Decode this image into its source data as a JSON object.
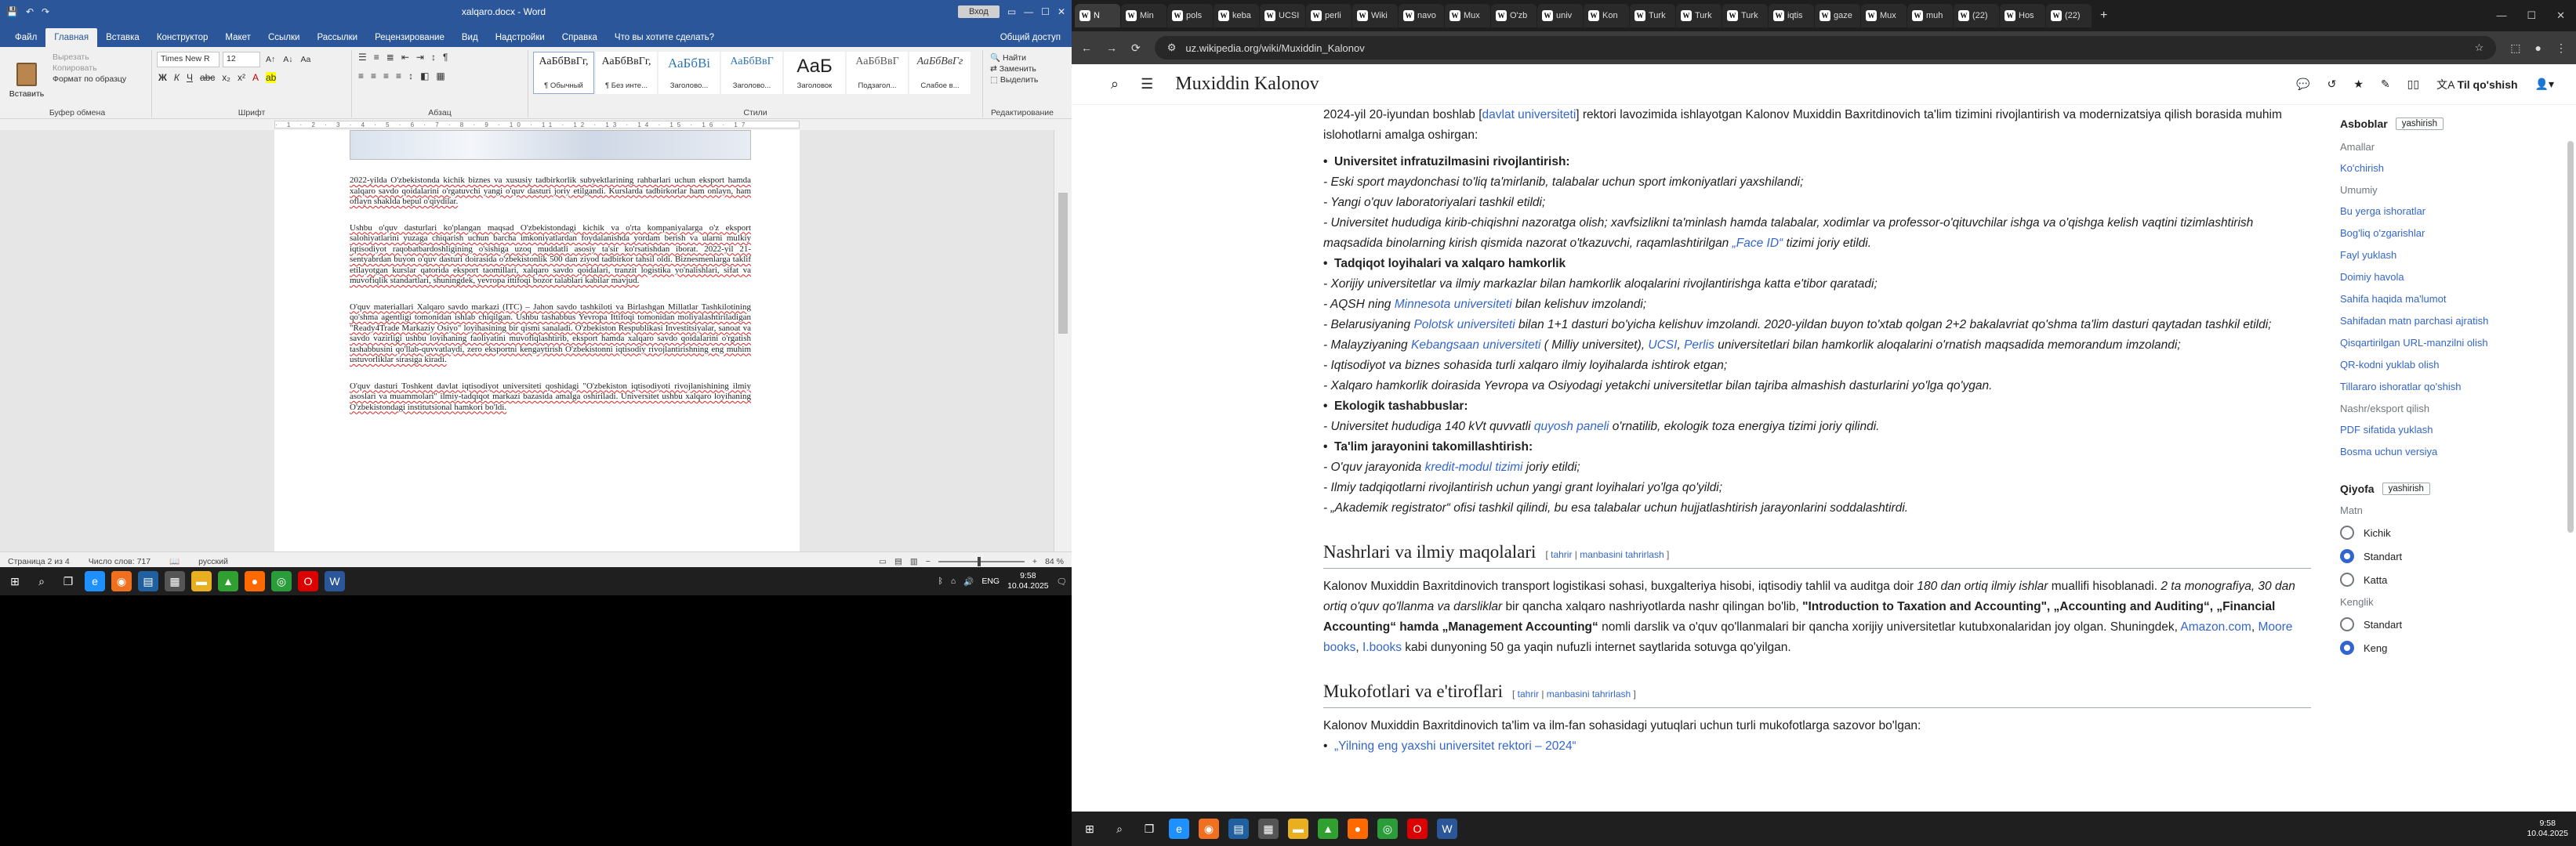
{
  "word": {
    "title": "xalqaro.docx - Word",
    "login": "Вход",
    "tabs": [
      "Файл",
      "Главная",
      "Вставка",
      "Конструктор",
      "Макет",
      "Ссылки",
      "Рассылки",
      "Рецензирование",
      "Вид",
      "Надстройки",
      "Справка",
      "Что вы хотите сделать?"
    ],
    "share": "Общий доступ",
    "clipboard": {
      "paste": "Вставить",
      "cut": "Вырезать",
      "copy": "Копировать",
      "format": "Формат по образцу",
      "label": "Буфер обмена"
    },
    "font": {
      "name": "Times New R",
      "size": "12",
      "label": "Шрифт"
    },
    "para_label": "Абзац",
    "styles": {
      "label": "Стили",
      "items": [
        {
          "sample": "АаБбВвГг,",
          "name": "¶ Обычный"
        },
        {
          "sample": "АаБбВвГг,",
          "name": "¶ Без инте..."
        },
        {
          "sample": "АаБбВі",
          "name": "Заголово..."
        },
        {
          "sample": "АаБбВвГ",
          "name": "Заголово..."
        },
        {
          "sample": "АаБ",
          "name": "Заголовок"
        },
        {
          "sample": "АаБбВвГ",
          "name": "Подзагол..."
        },
        {
          "sample": "АаБбВвГг",
          "name": "Слабое в..."
        }
      ]
    },
    "editing": {
      "find": "Найти",
      "replace": "Заменить",
      "select": "Выделить",
      "label": "Редактирование"
    },
    "doc": {
      "p1": "2022-yilda O'zbekistonda kichik biznes va xususiy tadbirkorlik subyektlarining rahbarlari uchun eksport hamda xalqaro savdo qoidalarini o'rgatuvchi yangi o'quv dasturi joriy etilgandi. Kurslarda tadbirkorlar ham onlayn, ham oflayn shaklda bepul o'qiydilar.",
      "p2": "Ushbu o'quv dasturlari ko'plangan maqsad O'zbekistondagi kichik va o'rta kompaniyalarga o'z eksport salohiyatlarini yuzaga chiqarish uchun barcha imkoniyatlardan foydalanishda yordam berish va ularni mulkiy iqtisodiyot raqobatbardoshligining o'sishiga uzoq muddatli asosiy ta'sir ko'rsatishdan iborat. 2022-yil 21-sentyabrdan buyon o'quv dasturi doirasida o'zbekistonlik 500 dan ziyod tadbirkor tahsil oldi. Biznesmenlarga taklif etilayotgan kurslar qatorida eksport taomillari, xalqaro savdo qoidalari, tranzit logistika yo'nalishlari, sifat va muvofiqlik standartlari, shuningdek, yevropa ittifoqi bozor talablari kabilar mavjud.",
      "p3": "O'quv materiallari Xalqaro savdo markazi (ITC) – Jahon savdo tashkiloti va Birlashgan Millatlar Tashkilotining qo'shma agentligi tomonidan ishlab chiqilgan. Ushbu tashabbus Yevropa Ittifoqi tomonidan moliyalashtiriladigan \"Ready4Trade Markaziy Osiyo\" loyihasining bir qismi sanaladi. O'zbekiston Respublikasi Investitsiyalar, sanoat va savdo vazirligi ushbu loyihaning faoliyatini muvofiqlashtirib, eksport hamda xalqaro savdo qoidalarini o'rgatish tashabbusini qo'llab-quvvatlaydi, zero eksportni kengaytirish O'zbekistonni iqtisodiy rivojlantirishning eng muhim ustuvorliklar sirasiga kiradi.",
      "p4": "O'quv dasturi Toshkent davlat iqtisodiyot universiteti qoshidagi \"O'zbekiston iqtisodiyoti rivojlanishining ilmiy asoslari va muammolari\" ilmiy-tadqiqot markazi bazasida amalga oshiriladi. Universitet ushbu xalqaro loyihaning O'zbekistondagi institutsional hamkori bo'ldi."
    },
    "status": {
      "page": "Страница 2 из 4",
      "words": "Число слов: 717",
      "lang": "русский",
      "zoom": "84 %"
    },
    "taskbar": {
      "lang": "ENG",
      "time": "9:58",
      "date": "10.04.2025"
    }
  },
  "browser": {
    "tabs": [
      "N",
      "Min",
      "pols",
      "keba",
      "UCSI",
      "perli",
      "Wiki",
      "navo",
      "Mux",
      "O'zb",
      "univ",
      "Kon",
      "Turk",
      "Turk",
      "Turk",
      "iqtis",
      "gaze",
      "Mux",
      "muh",
      "(22)",
      "Hos",
      "(22)"
    ],
    "url": "uz.wikipedia.org/wiki/Muxiddin_Kalonov",
    "header": {
      "title": "Muxiddin Kalonov",
      "lang": "Til qo'shish"
    },
    "intro": {
      "a": "2024-yil 20-iyundan boshlab ",
      "link": "davlat universiteti",
      "b": "] rektori lavozimida ishlayotgan Kalonov Muxiddin Baxritdinovich ta'lim tizimini rivojlantirish va modernizatsiya qilish borasida muhim islohotlarni amalga oshirgan:"
    },
    "infra": {
      "h": "Universitet infratuzilmasini rivojlantirish:",
      "i1": "- Eski sport maydonchasi to'liq ta'mirlanib, talabalar uchun sport imkoniyatlari yaxshilandi;",
      "i2": "- Yangi o'quv laboratoriyalari tashkil etildi;",
      "i3a": "- Universitet hududiga kirib-chiqishni nazoratga olish; xavfsizlikni ta'minlash hamda talabalar, xodimlar va professor-o'qituvchilar ishga va o'qishga kelish vaqtini tizimlashtirish maqsadida binolarning kirish qismida nazorat o'tkazuvchi, raqamlashtirilgan ",
      "i3l": "„Face ID“",
      "i3b": " tizimi joriy etildi."
    },
    "coop": {
      "h": "Tadqiqot loyihalari va xalqaro hamkorlik",
      "i1": "- Xorijiy universitetlar va ilmiy markazlar bilan hamkorlik aloqalarini rivojlantirishga katta e'tibor qaratadi;",
      "i2a": "- AQSH ning ",
      "i2l": "Minnesota universiteti",
      "i2b": " bilan kelishuv imzolandi;",
      "i3a": "- Belarusiyaning ",
      "i3l": "Polotsk universiteti",
      "i3b": " bilan 1+1 dasturi bo'yicha kelishuv imzolandi. 2020-yildan buyon to'xtab qolgan 2+2 bakalavriat qo'shma ta'lim dasturi qaytadan tashkil etildi;",
      "i4a": "- Malayziyaning ",
      "i4l": "Kebangsaan universiteti",
      "i4b": " ( Milliy universitet), ",
      "i4l2": "UCSI",
      "i4c": ", ",
      "i4l3": "Perlis",
      "i4d": " universitetlari bilan hamkorlik aloqalarini o'rnatish maqsadida memorandum imzolandi;",
      "i5": "- Iqtisodiyot va biznes sohasida turli xalqaro ilmiy loyihalarda ishtirok etgan;",
      "i6": "- Xalqaro hamkorlik doirasida Yevropa va Osiyodagi yetakchi universitetlar bilan tajriba almashish dasturlarini yo'lga qo'ygan."
    },
    "eco": {
      "h": "Ekologik tashabbuslar:",
      "i1a": "- Universitet hududiga 140 kVt quvvatli ",
      "i1l": "quyosh paneli",
      "i1b": " o'rnatilib, ekologik toza energiya tizimi joriy qilindi."
    },
    "edu": {
      "h": "Ta'lim jarayonini takomillashtirish:",
      "i1a": "- O'quv jarayonida ",
      "i1l": "kredit-modul tizimi",
      "i1b": " joriy etildi;",
      "i2": "- Ilmiy tadqiqotlarni rivojlantirish uchun yangi grant loyihalari yo'lga qo'yildi;",
      "i3": "- „Akademik registrator“ ofisi tashkil qilindi, bu esa talabalar uchun hujjatlashtirish jarayonlarini soddalashtirdi."
    },
    "pub": {
      "h": "Nashrlari va ilmiy maqolalari",
      "edit": "tahrir",
      "editsrc": "manbasini tahrirlash",
      "t1": "Kalonov Muxiddin Baxritdinovich transport logistikasi sohasi, buxgalteriya hisobi, iqtisodiy tahlil va auditga doir ",
      "t1i": "180 dan ortiq ilmiy ishlar",
      "t2": " muallifi hisoblanadi. ",
      "t2i": "2 ta monografiya, 30 dan ortiq o'quv qo'llanma va darsliklar",
      "t3": " bir qancha xalqaro nashriyotlarda nashr qilingan bo'lib, ",
      "t3b": "\"Introduction to Taxation and Accounting\", „Accounting and Auditing“, „Financial Accounting“ hamda „Management Accounting“",
      "t4": " nomli darslik va o'quv qo'llanmalari bir qancha xorijiy universitetlar kutubxonalaridan joy olgan. Shuningdek, ",
      "l1": "Amazon.com",
      "l2": "Moore books",
      "l3": "I.books",
      "t5": " kabi dunyoning 50 ga yaqin nufuzli internet saytlarida sotuvga qo'yilgan."
    },
    "awards": {
      "h": "Mukofotlari va e'tiroflari",
      "t": "Kalonov Muxiddin Baxritdinovich ta'lim va ilm-fan sohasidagi yutuqlari uchun turli mukofotlarga sazovor bo'lgan:",
      "i1": "„Yilning eng yaxshi universitet rektori – 2024“"
    },
    "sidebar": {
      "tools": "Asboblar",
      "hide": "yashirish",
      "actions": "Amallar",
      "whatlinks": "Ko'chirish",
      "general": "Umumiy",
      "links": [
        "Bu yerga ishoratlar",
        "Bog'liq o'zgarishlar",
        "Fayl yuklash",
        "Doimiy havola",
        "Sahifa haqida ma'lumot",
        "Sahifadan matn parchasi ajratish",
        "Qisqartirilgan URL-manzilni olish",
        "QR-kodni yuklab olish",
        "Tillararo ishoratlar qo'shish"
      ],
      "printexport": "Nashr/eksport qilish",
      "plinks": [
        "PDF sifatida yuklash",
        "Bosma uchun versiya"
      ],
      "appearance": "Qiyofa",
      "text": "Matn",
      "t_opts": [
        "Kichik",
        "Standart",
        "Katta"
      ],
      "width": "Kenglik",
      "w_opts": [
        "Standart",
        "Keng"
      ]
    },
    "taskbar": {
      "time": "9:58",
      "date": "10.04.2025"
    }
  }
}
